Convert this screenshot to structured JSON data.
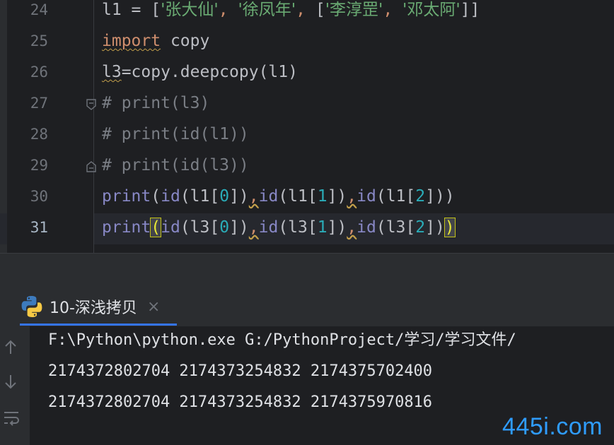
{
  "editor": {
    "line_numbers": [
      "24",
      "25",
      "26",
      "27",
      "28",
      "29",
      "30",
      "31"
    ],
    "current_line": "31",
    "lines": {
      "l24": {
        "var": "l1",
        "eq": " = ",
        "lb": "[",
        "s1": "'张大仙'",
        "c1": ", ",
        "s2": "'徐凤年'",
        "c2": ", ",
        "lb2": "[",
        "s3": "'李淳罡'",
        "c3": ", ",
        "s4": "'邓太阿'",
        "rb": "]]"
      },
      "l25": {
        "kw": "import",
        "rest": " copy"
      },
      "l26": {
        "var": "l3",
        "rest": "=copy.deepcopy(l1)"
      },
      "l27": {
        "text": "# print(l3)"
      },
      "l28": {
        "text": "# print(id(l1))"
      },
      "l29": {
        "text": "# print(id(l3))"
      },
      "l30": {
        "p1": "print",
        "p2": "(",
        "p3": "id",
        "p4": "(l1[",
        "n1": "0",
        "p5": "])",
        "cm1": ",",
        "p6": "id",
        "p7": "(l1[",
        "n2": "1",
        "p8": "])",
        "cm2": ",",
        "p9": "id",
        "p10": "(l1[",
        "n3": "2",
        "p11": "]))"
      },
      "l31": {
        "p1": "print",
        "p2": "(",
        "p3": "id",
        "p4": "(l3[",
        "n1": "0",
        "p5": "])",
        "cm1": ",",
        "p6": "id",
        "p7": "(l3[",
        "n2": "1",
        "p8": "])",
        "cm2": ",",
        "p9": "id",
        "p10": "(l3[",
        "n3": "2",
        "p11": "])",
        "p12": ")"
      }
    }
  },
  "run_panel": {
    "tab_label": "10-深浅拷贝",
    "close_glyph": "×",
    "icons": [
      "arrow-up-icon",
      "arrow-down-icon",
      "soft-wrap-icon"
    ],
    "output": [
      "F:\\Python\\python.exe G:/PythonProject/学习/学习文件/",
      "2174372802704 2174373254832 2174375702400",
      "2174372802704 2174373254832 2174375970816"
    ]
  },
  "watermark": "445i.com",
  "colors": {
    "editor_bg": "#1e1f22",
    "keyword": "#cf8e6d",
    "string": "#6aab73",
    "number": "#2aacb8",
    "builtin": "#8888c6",
    "comment": "#7a7e85",
    "accent": "#3574f0"
  }
}
